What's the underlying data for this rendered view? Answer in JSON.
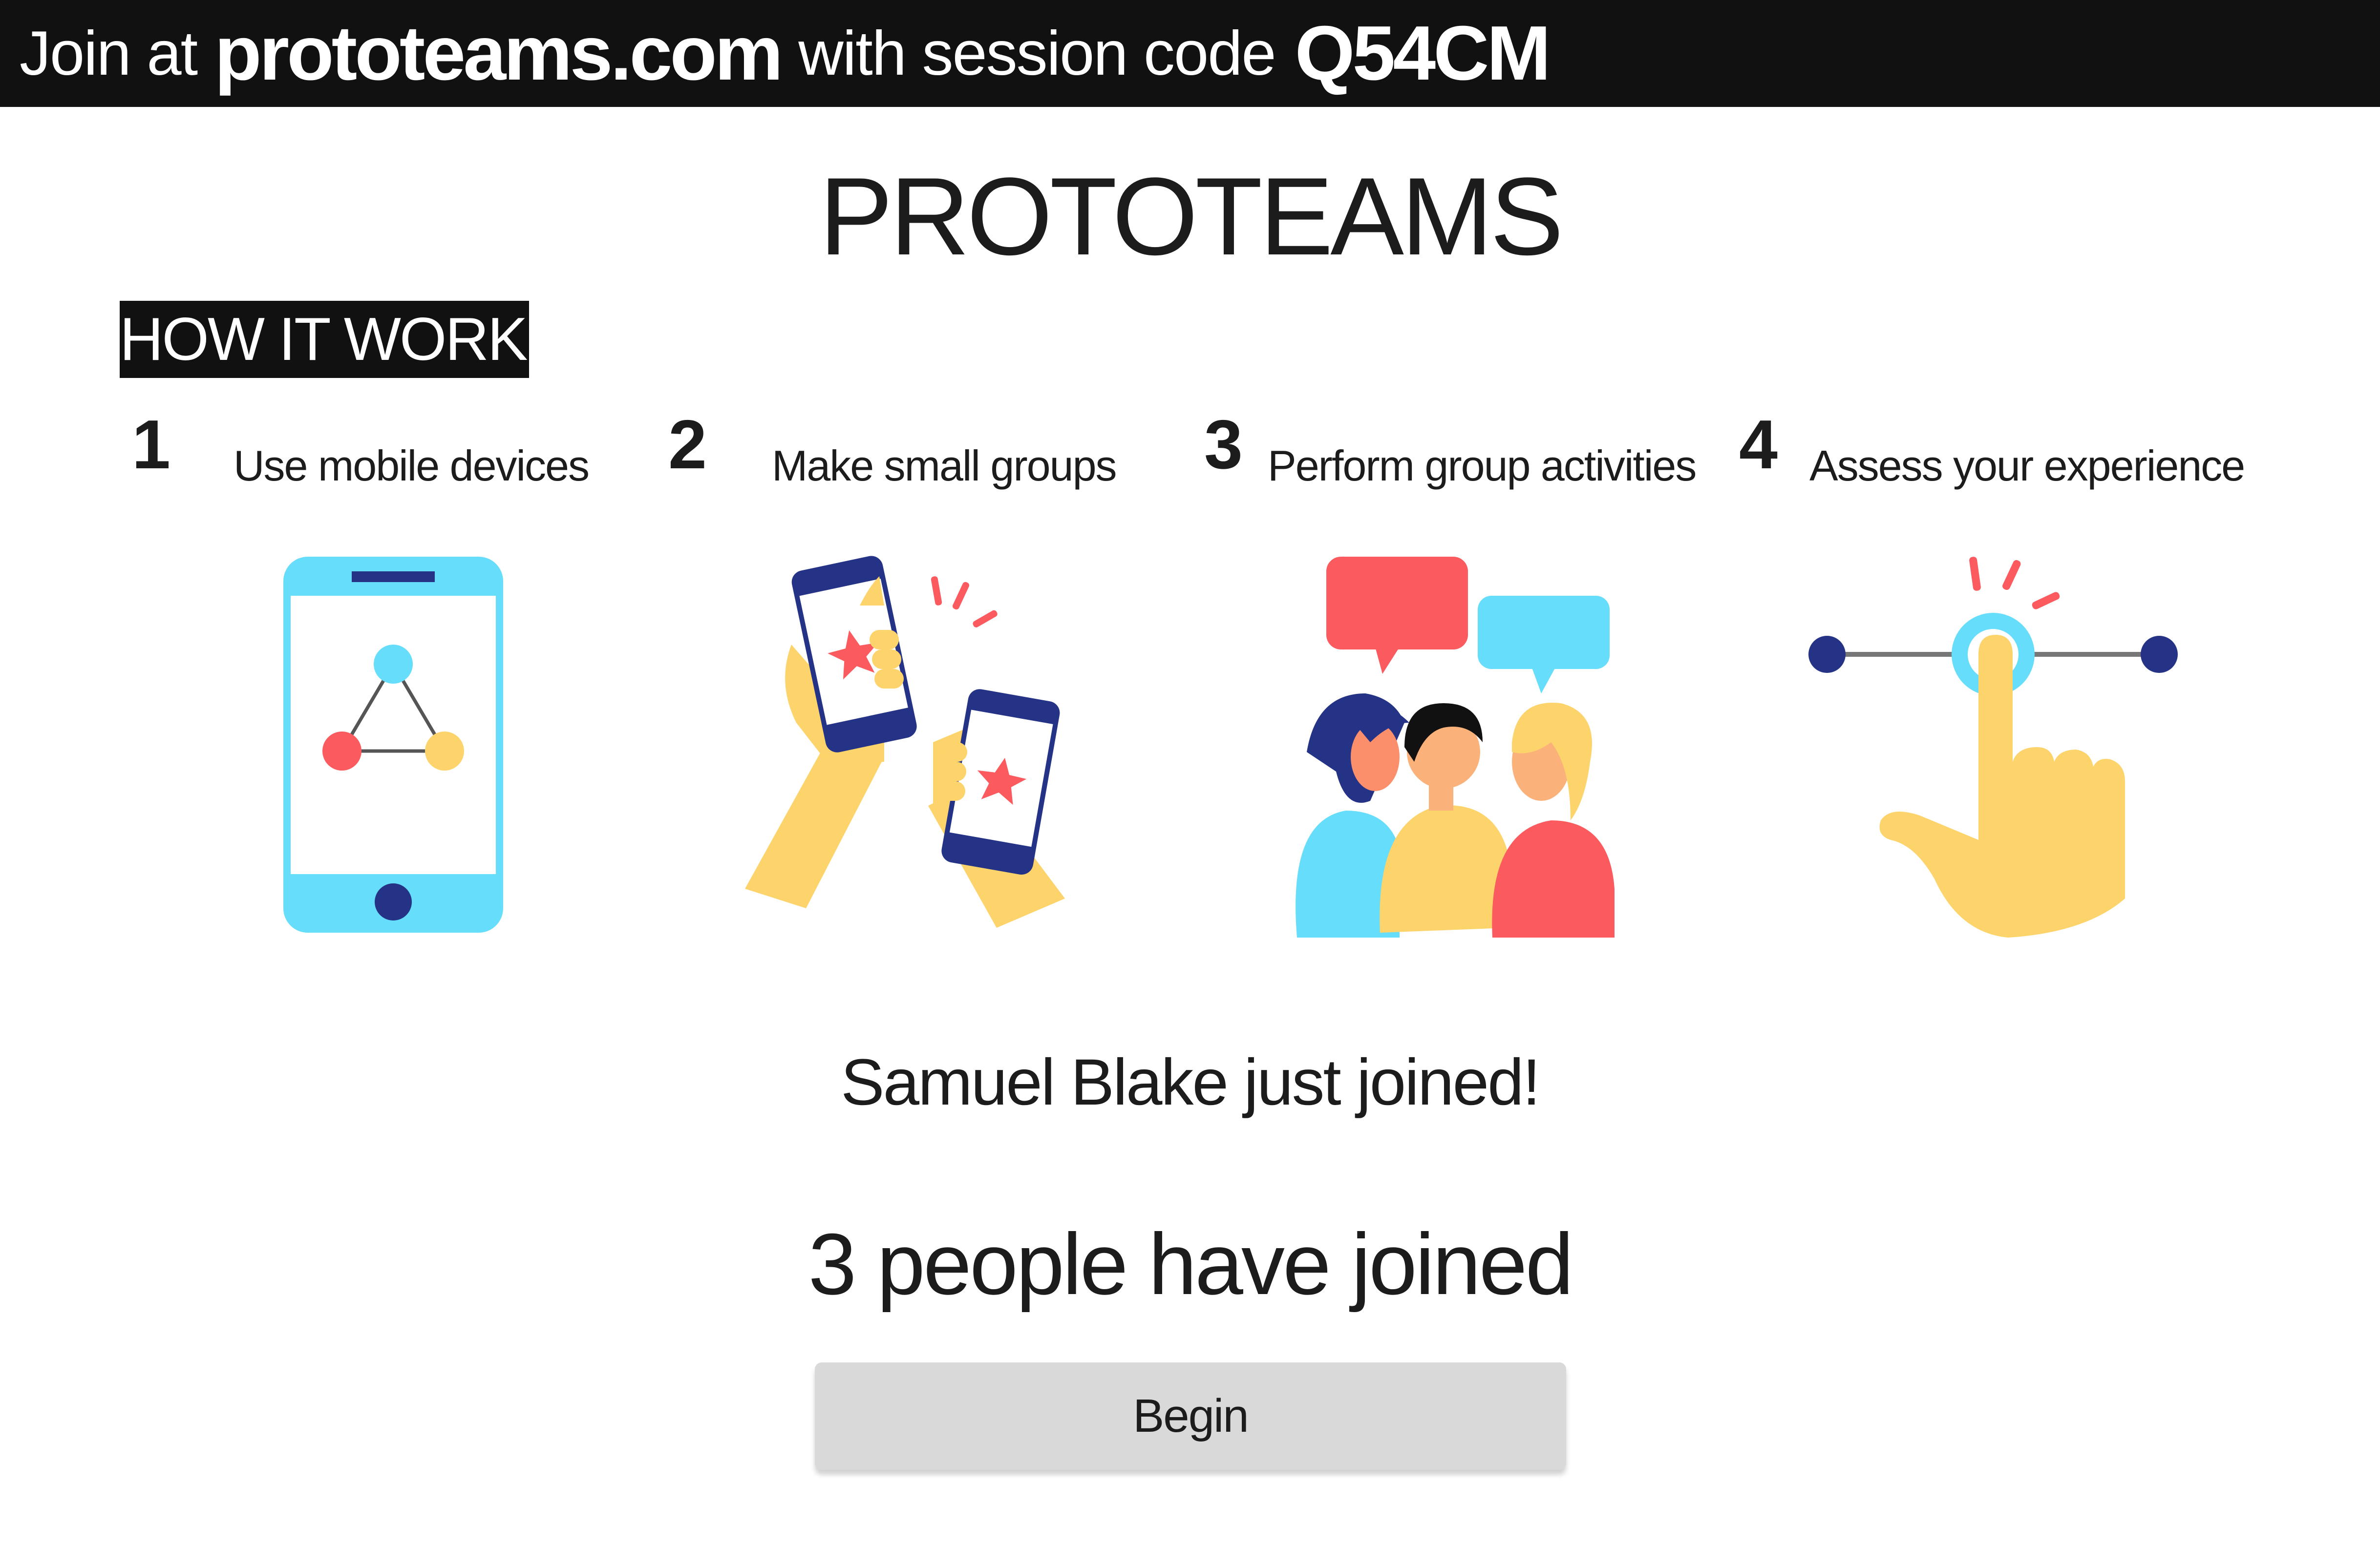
{
  "header": {
    "join_at": "Join at",
    "site": "prototeams.com",
    "with_code": "with session code",
    "code": "Q54CM"
  },
  "app": {
    "title": "PROTOTEAMS"
  },
  "how_it_works": {
    "heading": "HOW IT WORKS",
    "steps": [
      {
        "number": "1",
        "label": "Use mobile devices",
        "icon": "mobile-phone-icon"
      },
      {
        "number": "2",
        "label": "Make small groups",
        "icon": "phones-bump-icon"
      },
      {
        "number": "3",
        "label": "Perform group activities",
        "icon": "people-chatting-icon"
      },
      {
        "number": "4",
        "label": "Assess your experience",
        "icon": "slider-tap-icon"
      }
    ]
  },
  "status": {
    "latest_join": "Samuel Blake just joined!",
    "count_text": "3 people have joined"
  },
  "actions": {
    "begin_label": "Begin"
  },
  "colors": {
    "cyan": "#66ddfa",
    "red": "#fb5b5e",
    "yellow": "#fdd46b",
    "navy": "#253386",
    "bar": "#111111",
    "button": "#d9d9d9"
  }
}
